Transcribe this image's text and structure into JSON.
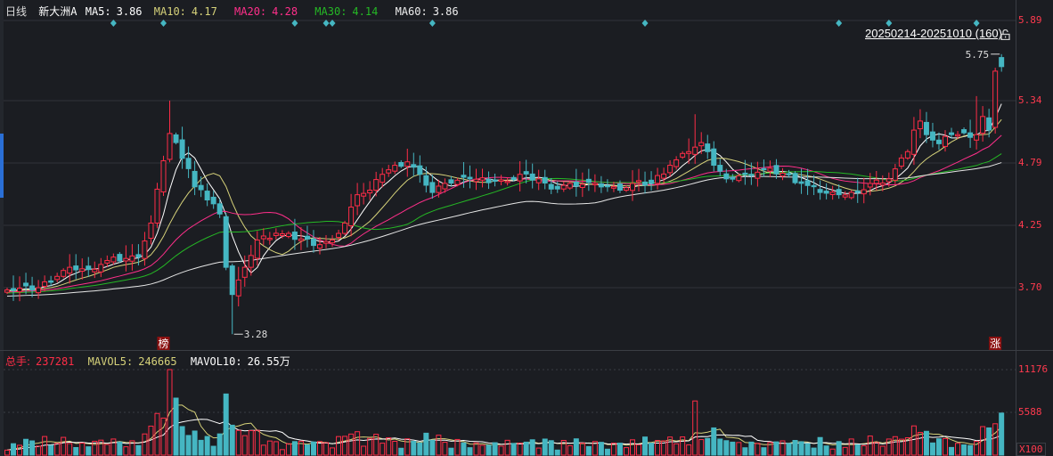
{
  "header": {
    "period": "日线",
    "stock": "新大洲A",
    "ma5_label": "MA5:",
    "ma5": "3.86",
    "ma10_label": "MA10:",
    "ma10": "4.17",
    "ma20_label": "MA20:",
    "ma20": "4.28",
    "ma30_label": "MA30:",
    "ma30": "4.14",
    "ma60_label": "MA60:",
    "ma60": "3.86"
  },
  "range": {
    "text": "20250214-20251010 (160)",
    "lock_icon": "lock-open-icon"
  },
  "volume_header": {
    "total_label": "总手:",
    "total": "237281",
    "mavol5_label": "MAVOL5:",
    "mavol5": "246665",
    "mavol10_label": "MAVOL10:",
    "mavol10": "26.55万"
  },
  "price_axis": [
    "5.89",
    "5.34",
    "4.79",
    "4.25",
    "3.70"
  ],
  "volume_axis": [
    "11176",
    "5588",
    "X100"
  ],
  "annotations": {
    "high": "5.75",
    "low": "3.28",
    "tag_left": "榜",
    "tag_right": "涨"
  },
  "colors": {
    "up": "#ff2d47",
    "down": "#45b6c2",
    "ma5": "#ffffff",
    "ma10": "#d6d27a",
    "ma20": "#ff2f8a",
    "ma30": "#25b825",
    "ma60": "#e6e6e6"
  },
  "chart_data": {
    "type": "candlestick",
    "days": 160,
    "close_keypoints": [
      [
        0,
        3.67
      ],
      [
        5,
        3.69
      ],
      [
        10,
        3.87
      ],
      [
        13,
        3.85
      ],
      [
        16,
        3.93
      ],
      [
        21,
        3.96
      ],
      [
        23,
        4.26
      ],
      [
        25,
        4.81
      ],
      [
        26,
        5.05
      ],
      [
        27,
        4.97
      ],
      [
        29,
        4.74
      ],
      [
        30,
        4.58
      ],
      [
        33,
        4.43
      ],
      [
        34,
        4.34
      ],
      [
        35,
        3.87
      ],
      [
        36,
        3.63
      ],
      [
        38,
        3.87
      ],
      [
        40,
        4.11
      ],
      [
        43,
        4.17
      ],
      [
        47,
        4.12
      ],
      [
        50,
        4.07
      ],
      [
        52,
        4.11
      ],
      [
        54,
        4.26
      ],
      [
        56,
        4.51
      ],
      [
        58,
        4.55
      ],
      [
        60,
        4.69
      ],
      [
        62,
        4.77
      ],
      [
        64,
        4.8
      ],
      [
        66,
        4.69
      ],
      [
        68,
        4.53
      ],
      [
        70,
        4.61
      ],
      [
        74,
        4.65
      ],
      [
        80,
        4.63
      ],
      [
        82,
        4.69
      ],
      [
        85,
        4.65
      ],
      [
        87,
        4.56
      ],
      [
        90,
        4.61
      ],
      [
        94,
        4.61
      ],
      [
        96,
        4.58
      ],
      [
        98,
        4.55
      ],
      [
        100,
        4.61
      ],
      [
        103,
        4.61
      ],
      [
        106,
        4.77
      ],
      [
        109,
        4.89
      ],
      [
        111,
        4.97
      ],
      [
        112,
        4.89
      ],
      [
        113,
        4.77
      ],
      [
        115,
        4.65
      ],
      [
        118,
        4.69
      ],
      [
        121,
        4.73
      ],
      [
        124,
        4.7
      ],
      [
        127,
        4.61
      ],
      [
        130,
        4.53
      ],
      [
        133,
        4.51
      ],
      [
        136,
        4.53
      ],
      [
        138,
        4.61
      ],
      [
        141,
        4.65
      ],
      [
        144,
        4.89
      ],
      [
        145,
        5.08
      ],
      [
        146,
        5.16
      ],
      [
        147,
        5.04
      ],
      [
        149,
        4.96
      ],
      [
        151,
        5.04
      ],
      [
        155,
        5.04
      ],
      [
        156,
        5.2
      ],
      [
        157,
        5.08
      ],
      [
        158,
        5.6
      ],
      [
        159,
        5.64
      ]
    ],
    "last_open": 5.72,
    "price_high": 5.75,
    "price_low": 3.28,
    "marker_days": [
      17,
      25,
      46,
      51,
      52,
      68,
      102,
      133,
      141,
      155
    ],
    "ma_periods": [
      5,
      10,
      20,
      30,
      60
    ],
    "volume_ylim": [
      0,
      13000
    ]
  }
}
